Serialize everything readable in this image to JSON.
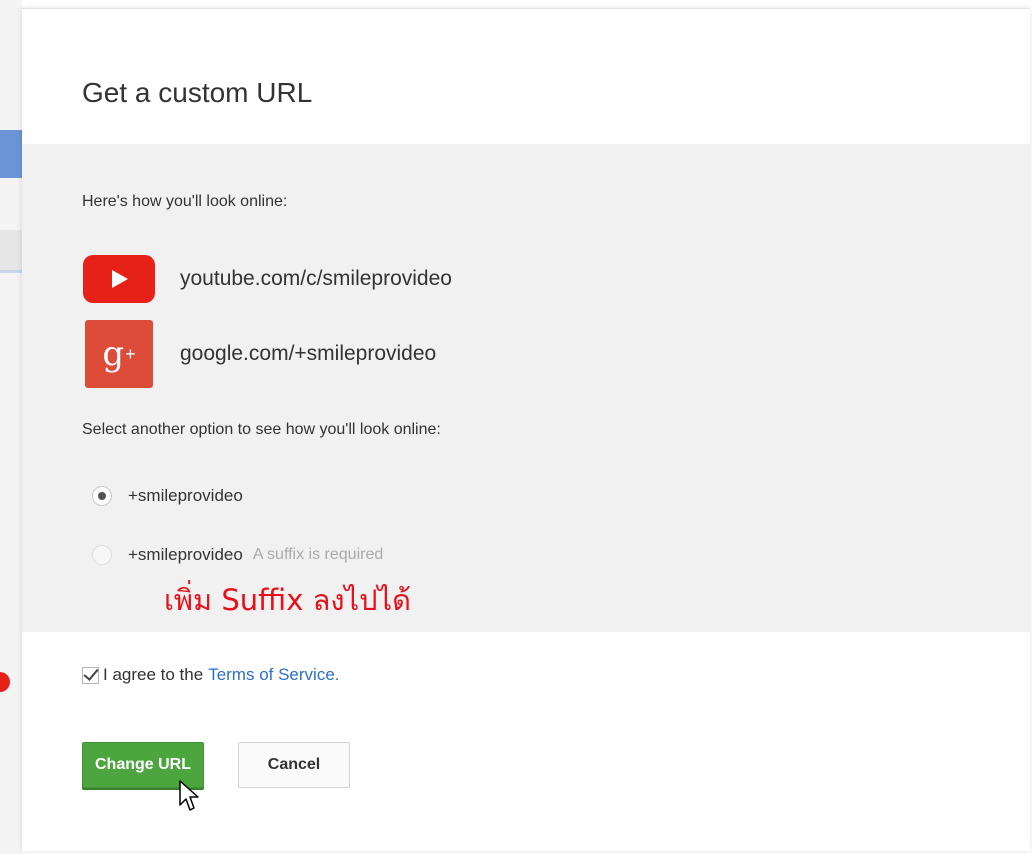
{
  "dialog": {
    "title": "Get a custom URL",
    "preview_label": "Here's how you'll look online:",
    "urls": [
      {
        "icon": "youtube-icon",
        "text": "youtube.com/c/smileprovideo"
      },
      {
        "icon": "google-plus-icon",
        "text": "google.com/+smileprovideo",
        "icon_glyph": "g",
        "icon_plus": "+"
      }
    ],
    "select_label": "Select another option to see how you'll look online:",
    "options": [
      {
        "label": "+smileprovideo",
        "selected": true
      },
      {
        "label": "+smileprovideo",
        "hint": "A suffix is required",
        "selected": false
      }
    ],
    "annotation": "เพิ่ม Suffix ลงไปได้",
    "agree_text": "I agree to the",
    "terms_link": "Terms of Service.",
    "agree_checked": true,
    "change_button": "Change URL",
    "cancel_button": "Cancel"
  },
  "colors": {
    "youtube_red": "#e62117",
    "google_plus_red": "#dd4b39",
    "primary_green": "#4ca53f",
    "link_blue": "#2b6fc8",
    "annotation_red": "#e8101a"
  }
}
